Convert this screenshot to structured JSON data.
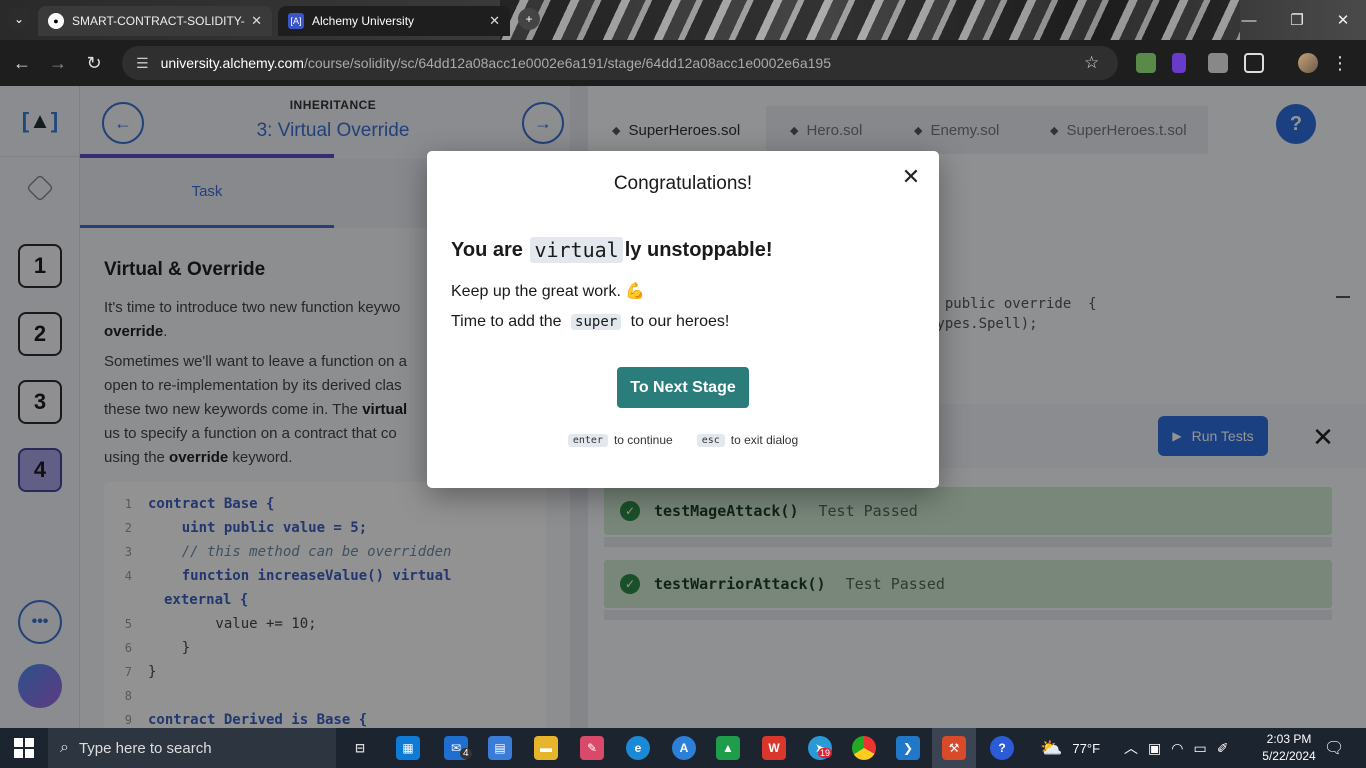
{
  "browser": {
    "tabs": [
      {
        "title": "SMART-CONTRACT-SOLIDITY-F",
        "icon": "github-icon",
        "active": false
      },
      {
        "title": "Alchemy University",
        "icon": "alchemy-icon",
        "active": true
      }
    ],
    "url_host": "university.alchemy.com",
    "url_path": "/course/solidity/sc/64dd12a08acc1e0002e6a191/stage/64dd12a08acc1e0002e6a195"
  },
  "lesson": {
    "kicker": "INHERITANCE",
    "title": "3: Virtual Override",
    "task_tab": "Task",
    "heading": "Virtual & Override",
    "para1_a": "It's time to introduce two new function keywo",
    "para1_b": "override",
    "para1_c": ".",
    "para2_a": "Sometimes we'll want to leave a function on a",
    "para2_b": "open to re-implementation by its derived clas",
    "para2_c": "these two new keywords come in. The ",
    "para2_d": "virtual",
    "para2_e": "us to specify a function on a contract that co",
    "para2_f": "using the ",
    "para2_g": "override",
    "para2_h": " keyword."
  },
  "stages": [
    "1",
    "2",
    "3",
    "4"
  ],
  "code": {
    "lines": [
      {
        "n": "1",
        "text": "contract Base {"
      },
      {
        "n": "2",
        "text": "    uint public value = 5;"
      },
      {
        "n": "3",
        "text": "    // this method can be overridden"
      },
      {
        "n": "4",
        "text": "    function increaseValue() virtual"
      },
      {
        "n": "",
        "text": "external {"
      },
      {
        "n": "5",
        "text": "        value += 10;"
      },
      {
        "n": "6",
        "text": "    }"
      },
      {
        "n": "7",
        "text": "}"
      },
      {
        "n": "8",
        "text": ""
      },
      {
        "n": "9",
        "text": "contract Derived is Base {"
      }
    ]
  },
  "editor": {
    "files": [
      "SuperHeroes.sol",
      "Hero.sol",
      "Enemy.sol",
      "SuperHeroes.t.sol"
    ],
    "snippet_1": ") public override  {",
    "snippet_2": "Types.Spell);",
    "run_tests": "Run Tests",
    "tests": [
      {
        "name": "testMageAttack()",
        "status": "Test Passed"
      },
      {
        "name": "testWarriorAttack()",
        "status": "Test Passed"
      }
    ]
  },
  "modal": {
    "title": "Congratulations!",
    "headline_pre": "You are ",
    "headline_code": "virtual",
    "headline_post": "ly unstoppable!",
    "line1": "Keep up the great work. 💪",
    "line2_pre": "Time to add the ",
    "line2_code": "super",
    "line2_post": " to our heroes!",
    "button": "To Next Stage",
    "hint_enter_key": "enter",
    "hint_enter": "to continue",
    "hint_esc_key": "esc",
    "hint_esc": "to exit dialog"
  },
  "taskbar": {
    "search_placeholder": "Type here to search",
    "weather": "77°F",
    "time": "2:03 PM",
    "date": "5/22/2024",
    "mail_badge": "4",
    "telegram_badge": "19"
  },
  "colors": {
    "accent": "#3b6fd0",
    "modal_button": "#2a7d7b",
    "test_pass_bg": "#cfe8d2",
    "current_stage": "#a9a4e8"
  }
}
